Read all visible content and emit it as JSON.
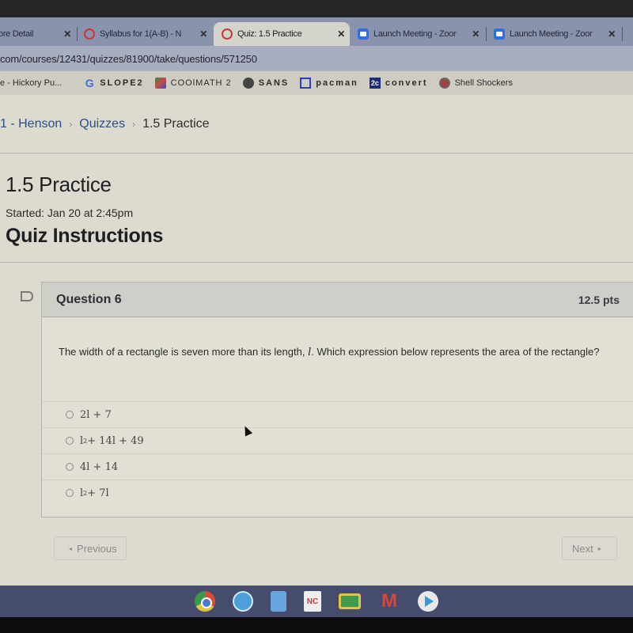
{
  "browser": {
    "tabs": [
      {
        "label": "ore Detail",
        "favicon": "page-icon",
        "active": false
      },
      {
        "label": "Syllabus for 1(A-B) - N",
        "favicon": "canvas-icon",
        "active": false
      },
      {
        "label": "Quiz: 1.5 Practice",
        "favicon": "canvas-icon",
        "active": true
      },
      {
        "label": "Launch Meeting - Zoor",
        "favicon": "zoom-icon",
        "active": false
      },
      {
        "label": "Launch Meeting - Zoor",
        "favicon": "zoom-icon",
        "active": false
      }
    ],
    "close_glyph": "✕",
    "url": "com/courses/12431/quizzes/81900/take/questions/571250",
    "bookmarks": [
      {
        "label": "e - Hickory Pu...",
        "icon": ""
      },
      {
        "label": "SLOPE2",
        "icon": "google-icon",
        "glyph": "G"
      },
      {
        "label": "COOlMATH 2",
        "icon": "coolmath-icon"
      },
      {
        "label": "SANS",
        "icon": "sans-icon"
      },
      {
        "label": "pacman",
        "icon": "pacman-icon"
      },
      {
        "label": "convert",
        "icon": "convert-icon",
        "glyph": "2c"
      },
      {
        "label": "Shell Shockers",
        "icon": "shell-shockers-icon"
      }
    ]
  },
  "breadcrumb": {
    "items": [
      "1 - Henson",
      "Quizzes"
    ],
    "current": "1.5 Practice",
    "separator": "›"
  },
  "quiz": {
    "title": "1.5 Practice",
    "started": "Started: Jan 20 at 2:45pm",
    "instructions_heading": "Quiz Instructions"
  },
  "question": {
    "name": "Question 6",
    "points": "12.5 pts",
    "text_before": "The width of a rectangle is seven more than its length, ",
    "variable": "l",
    "text_after": ". Which expression below represents the area of the rectangle?",
    "answers": [
      {
        "base": "2l + 7",
        "sup": "",
        "rest": ""
      },
      {
        "base": "l",
        "sup": "2",
        "rest": " + 14l + 49"
      },
      {
        "base": "4l + 14",
        "sup": "",
        "rest": ""
      },
      {
        "base": "l",
        "sup": "2",
        "rest": " + 7l"
      }
    ],
    "selected": null
  },
  "navigation": {
    "previous": "Previous",
    "next": "Next",
    "prev_glyph": "◂",
    "next_glyph": "▸"
  },
  "shelf": {
    "apps": [
      "chrome",
      "zoom",
      "docs",
      "nc",
      "classroom",
      "gmail",
      "play-store"
    ],
    "nc_label": "NC",
    "gmail_glyph": "M"
  }
}
